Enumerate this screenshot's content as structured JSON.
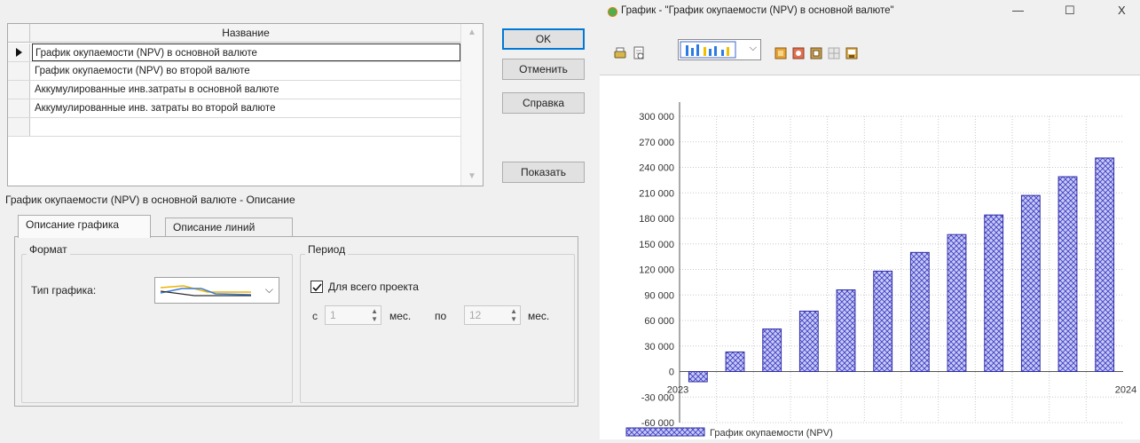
{
  "dialog": {
    "grid": {
      "header": "Название",
      "rows": [
        "График окупаемости (NPV) в основной валюте",
        "График окупаемости (NPV) во второй валюте",
        "Аккумулированные инв.затраты в основной валюте",
        "Аккумулированные инв. затраты во второй валюте"
      ]
    },
    "buttons": {
      "ok": "OK",
      "cancel": "Отменить",
      "help": "Справка",
      "show": "Показать"
    },
    "description_caption": "График окупаемости (NPV) в основной валюте - Описание",
    "tabs": [
      "Описание графика",
      "Описание линий"
    ],
    "format": {
      "group_label": "Формат",
      "chart_type_label": "Тип графика:"
    },
    "period": {
      "group_label": "Период",
      "whole_project_label": "Для всего проекта",
      "whole_project_checked": true,
      "from_prefix": "с",
      "from_value": "1",
      "from_unit": "мес.",
      "to_prefix": "по",
      "to_value": "12",
      "to_unit": "мес."
    }
  },
  "chart_window": {
    "title": "График - \"График окупаемости (NPV) в основной валюте\"",
    "controls": {
      "minimize": "—",
      "maximize": "☐",
      "close": "X"
    },
    "toolbar_icons": [
      "print-icon",
      "print-preview-icon",
      "chart-type-icon",
      "copy-icon",
      "color-icon",
      "settings-icon",
      "grid-icon",
      "export-icon"
    ]
  },
  "chart_data": {
    "type": "bar",
    "series": [
      {
        "name": "График окупаемости (NPV)",
        "values": [
          -12000,
          23000,
          50000,
          71000,
          96000,
          118000,
          140000,
          161000,
          184000,
          207000,
          229000,
          251000
        ]
      }
    ],
    "y_ticks": [
      "300 000",
      "270 000",
      "240 000",
      "210 000",
      "180 000",
      "150 000",
      "120 000",
      "90 000",
      "60 000",
      "30 000",
      "0",
      "-30 000",
      "-60 000"
    ],
    "ylim": [
      -60000,
      300000
    ],
    "x_start_label": "2023",
    "x_end_label": "2024",
    "grid": true,
    "legend_position": "bottom-left",
    "bar_fill": "#c9cbf2",
    "bar_hatch": "#3f3fc8"
  }
}
